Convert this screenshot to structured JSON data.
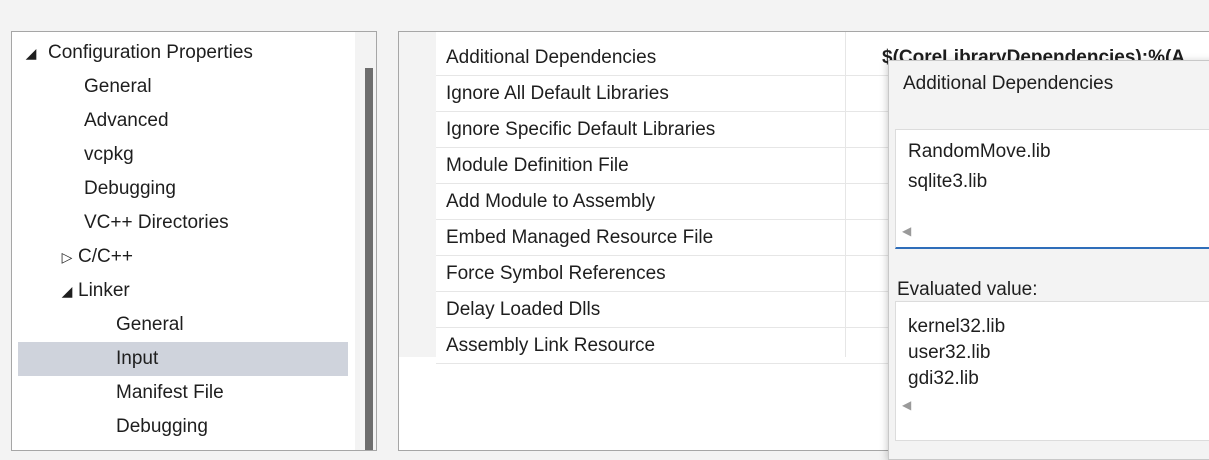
{
  "tree": {
    "items": [
      {
        "label": "Configuration Properties",
        "glyph": "◢"
      },
      {
        "label": "General"
      },
      {
        "label": "Advanced"
      },
      {
        "label": "vcpkg"
      },
      {
        "label": "Debugging"
      },
      {
        "label": "VC++ Directories"
      },
      {
        "label": "C/C++",
        "glyph": "▷"
      },
      {
        "label": "Linker",
        "glyph": "◢"
      },
      {
        "label": "General"
      },
      {
        "label": "Input",
        "selected": true
      },
      {
        "label": "Manifest File"
      },
      {
        "label": "Debugging"
      }
    ]
  },
  "grid": {
    "rows": [
      {
        "name": "Additional Dependencies",
        "value": "$(CoreLibraryDependencies);%(A"
      },
      {
        "name": "Ignore All Default Libraries"
      },
      {
        "name": "Ignore Specific Default Libraries"
      },
      {
        "name": "Module Definition File"
      },
      {
        "name": "Add Module to Assembly"
      },
      {
        "name": "Embed Managed Resource File"
      },
      {
        "name": "Force Symbol References"
      },
      {
        "name": "Delay Loaded Dlls"
      },
      {
        "name": "Assembly Link Resource"
      }
    ]
  },
  "popup": {
    "title": "Additional Dependencies",
    "edit_lines": [
      "RandomMove.lib",
      "sqlite3.lib"
    ],
    "evaluated_label": "Evaluated value:",
    "evaluated_lines": [
      "kernel32.lib",
      "user32.lib",
      "gdi32.lib"
    ]
  },
  "icons": {
    "expanded": "expanded-triangle-icon",
    "collapsed": "collapsed-triangle-icon",
    "scroll_left": "scroll-left-icon"
  },
  "colors": {
    "selection": "#cfd3dc",
    "focus_underline": "#2f6eba",
    "scroll_thumb": "#6e6e6e"
  }
}
